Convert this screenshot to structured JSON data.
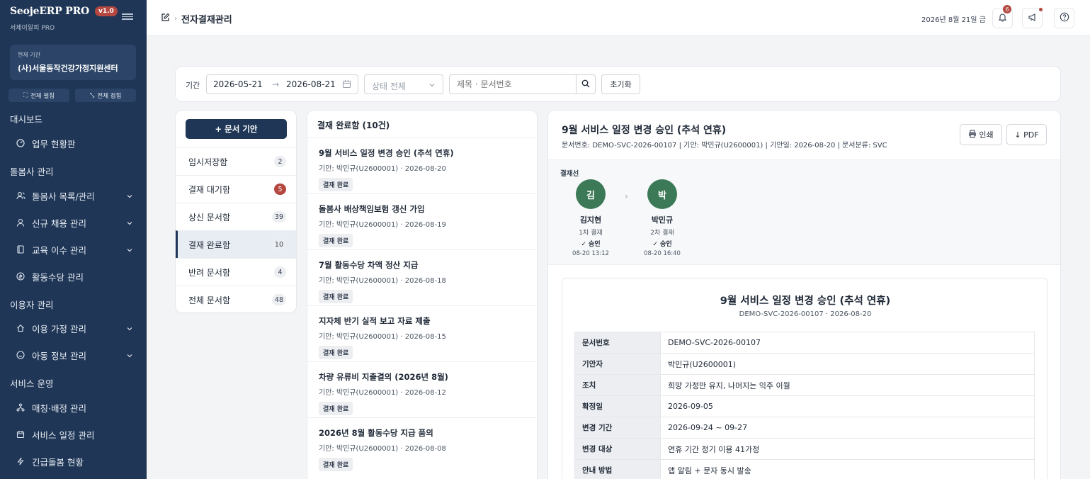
{
  "brand": {
    "name": "SeojeERP PRO",
    "version": "v1.0",
    "subtitle": "서제이알피 PRO"
  },
  "org": {
    "label": "현재 기관",
    "name": "(사)서울동작건강가정지원센터"
  },
  "sidebar_buttons": {
    "expand": "전체 펼침",
    "collapse": "전체 접힘"
  },
  "nav": {
    "dashboard": {
      "title": "대시보드",
      "items": [
        {
          "label": "업무 현황판",
          "icon": "gauge-icon"
        }
      ]
    },
    "caregiver": {
      "title": "돌봄사 관리",
      "items": [
        {
          "label": "돌봄사 목록/관리",
          "icon": "users-icon"
        },
        {
          "label": "신규 채용 관리",
          "icon": "user-icon"
        },
        {
          "label": "교육 이수 관리",
          "icon": "book-icon"
        },
        {
          "label": "활동수당 관리",
          "icon": "coin-icon"
        }
      ]
    },
    "client": {
      "title": "이용자 관리",
      "items": [
        {
          "label": "이용 가정 관리",
          "icon": "home-icon"
        },
        {
          "label": "아동 정보 관리",
          "icon": "smile-icon"
        }
      ]
    },
    "service": {
      "title": "서비스 운영",
      "items": [
        {
          "label": "매칭·배정 관리",
          "icon": "network-icon"
        },
        {
          "label": "서비스 일정 관리",
          "icon": "calendar-icon"
        },
        {
          "label": "긴급돌봄 현황",
          "icon": "bolt-icon"
        }
      ]
    }
  },
  "header": {
    "breadcrumb_sep": "›",
    "title": "전자결재관리",
    "date": "2026년 8월 21일 금",
    "notification_count": "6"
  },
  "filter": {
    "label": "기간",
    "date_from": "2026-05-21",
    "date_to": "2026-08-21",
    "range_arrow": "→",
    "status_placeholder": "상태 전체",
    "search_placeholder": "제목 · 문서번호",
    "reset": "초기화"
  },
  "boxes": {
    "new_doc": "+ 문서 기안",
    "items": [
      {
        "label": "임시저장함",
        "count": "2"
      },
      {
        "label": "결재 대기함",
        "count": "5"
      },
      {
        "label": "상신 문서함",
        "count": "39"
      },
      {
        "label": "결재 완료함",
        "count": "10"
      },
      {
        "label": "반려 문서함",
        "count": "4"
      },
      {
        "label": "전체 문서함",
        "count": "48"
      }
    ]
  },
  "list": {
    "heading": "결재 완료함 (10건)",
    "items": [
      {
        "title": "9월 서비스 일정 변경 승인 (추석 연휴)",
        "meta": "기안: 박민규(U2600001) · 2026-08-20",
        "status": "결재 완료"
      },
      {
        "title": "돌봄사 배상책임보험 갱신 가입",
        "meta": "기안: 박민규(U2600001) · 2026-08-19",
        "status": "결재 완료"
      },
      {
        "title": "7월 활동수당 차액 정산 지급",
        "meta": "기안: 박민규(U2600001) · 2026-08-18",
        "status": "결재 완료"
      },
      {
        "title": "지자체 반기 실적 보고 자료 제출",
        "meta": "기안: 박민규(U2600001) · 2026-08-15",
        "status": "결재 완료"
      },
      {
        "title": "차량 유류비 지출결의 (2026년 8월)",
        "meta": "기안: 박민규(U2600001) · 2026-08-12",
        "status": "결재 완료"
      },
      {
        "title": "2026년 8월 활동수당 지급 품의",
        "meta": "기안: 박민규(U2600001) · 2026-08-08",
        "status": "결재 완료"
      }
    ]
  },
  "detail": {
    "title": "9월 서비스 일정 변경 승인 (추석 연휴)",
    "meta": "문서번호: DEMO-SVC-2026-00107 | 기안: 박민규(U2600001) | 기안일: 2026-08-20 | 문서분류: SVC",
    "print": "인쇄",
    "pdf": "↓ PDF",
    "line_label": "결재선",
    "approvers": [
      {
        "initial": "김",
        "name": "김지현",
        "step": "1차 결재",
        "result": "✓ 승인",
        "time": "08-20 13:12"
      },
      {
        "initial": "박",
        "name": "박민규",
        "step": "2차 결재",
        "result": "✓ 승인",
        "time": "08-20 16:40"
      }
    ],
    "line_arrow": "›",
    "doc": {
      "title": "9월 서비스 일정 변경 승인 (추석 연휴)",
      "subtitle": "DEMO-SVC-2026-00107 · 2026-08-20",
      "rows": [
        {
          "k": "문서번호",
          "v": "DEMO-SVC-2026-00107"
        },
        {
          "k": "기안자",
          "v": "박민규(U2600001)"
        },
        {
          "k": "조치",
          "v": "희망 가정만 유지, 나머지는 익주 이월"
        },
        {
          "k": "확정일",
          "v": "2026-09-05"
        },
        {
          "k": "변경 기간",
          "v": "2026-09-24 ~ 09-27"
        },
        {
          "k": "변경 대상",
          "v": "연휴 기간 정기 이용 41가정"
        },
        {
          "k": "안내 방법",
          "v": "앱 알림 + 문자 동시 발송"
        }
      ]
    }
  },
  "colors": {
    "sidebar": "#1f3656",
    "accent": "#b4473f",
    "approve": "#3c7a57"
  }
}
